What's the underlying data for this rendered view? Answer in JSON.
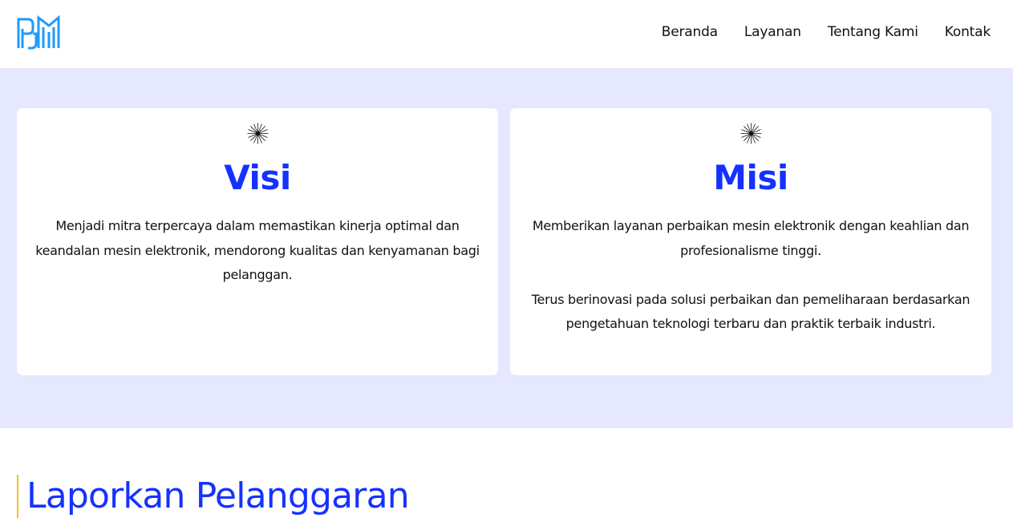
{
  "header": {
    "logo_icon": "pjm-logo-icon",
    "brand_color": "#1e9bff",
    "nav": [
      {
        "label": "Beranda"
      },
      {
        "label": "Layanan"
      },
      {
        "label": "Tentang Kami"
      },
      {
        "label": "Kontak"
      }
    ]
  },
  "vision_mission": {
    "background_color": "#e6e8ff",
    "accent_color": "#1432ff",
    "visi": {
      "icon": "sunburst-icon",
      "title": "Visi",
      "paragraphs": [
        "Menjadi mitra terpercaya dalam memastikan kinerja optimal dan keandalan mesin elektronik, mendorong kualitas dan kenyamanan bagi pelanggan."
      ]
    },
    "misi": {
      "icon": "sunburst-icon",
      "title": "Misi",
      "paragraphs": [
        "Memberikan layanan perbaikan mesin elektronik dengan keahlian dan profesionalisme tinggi.",
        "Terus berinovasi pada solusi perbaikan dan pemeliharaan berdasarkan pengetahuan teknologi terbaru dan praktik terbaik industri."
      ]
    }
  },
  "report": {
    "title": "Laporkan Pelanggaran",
    "border_color": "#f5c518"
  }
}
